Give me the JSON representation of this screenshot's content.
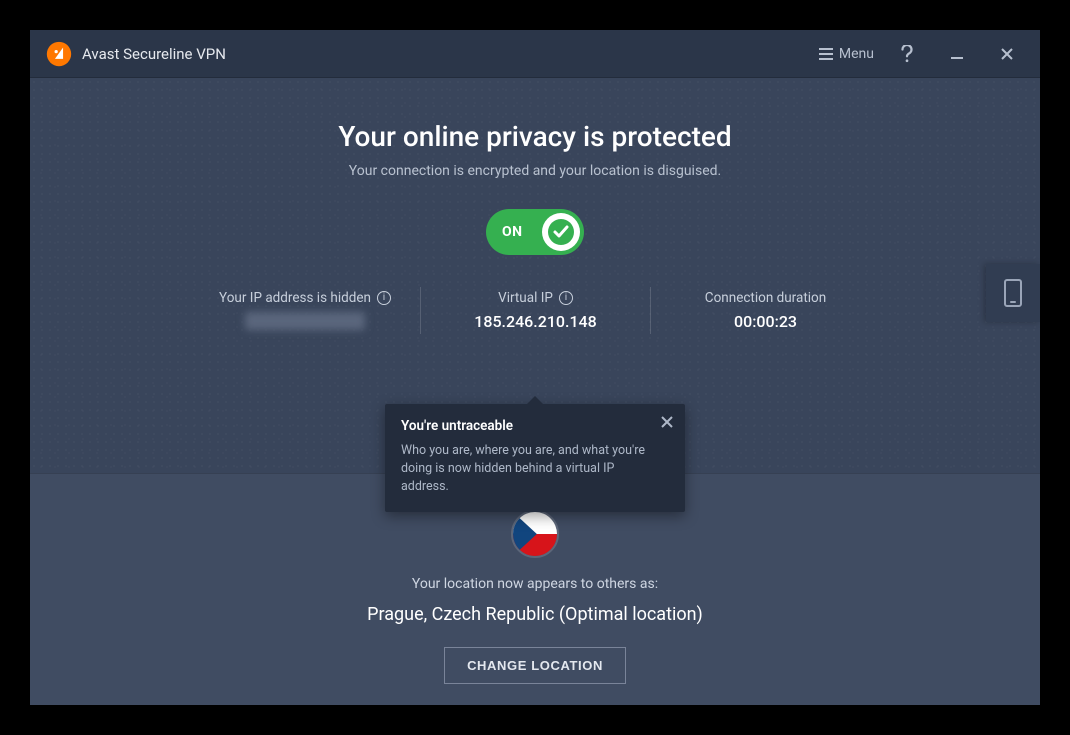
{
  "titlebar": {
    "app_name": "Avast Secureline VPN",
    "menu_label": "Menu"
  },
  "main": {
    "headline": "Your online privacy is protected",
    "subline": "Your connection is encrypted and your location is disguised.",
    "toggle": {
      "state_label": "ON",
      "on": true
    },
    "stats": {
      "ip_hidden_label": "Your IP address is hidden",
      "virtual_ip_label": "Virtual IP",
      "virtual_ip_value": "185.246.210.148",
      "duration_label": "Connection duration",
      "duration_value": "00:00:23"
    },
    "popover": {
      "title": "You're untraceable",
      "body": "Who you are, where you are, and what you're doing is now hidden behind a virtual IP address."
    }
  },
  "location": {
    "intro": "Your location now appears to others as:",
    "value": "Prague, Czech Republic (Optimal location)",
    "change_button": "CHANGE LOCATION",
    "flag": "cz"
  }
}
